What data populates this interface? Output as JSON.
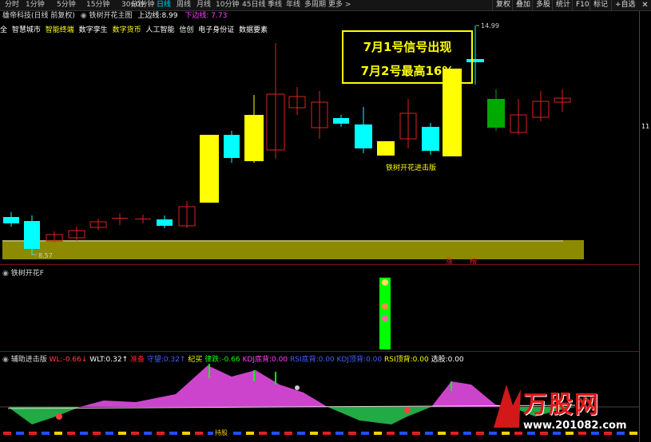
{
  "toolbar": {
    "timeframes": [
      "分时",
      "1分钟",
      "5分钟",
      "15分钟",
      "30分钟",
      "60分钟",
      "日线",
      "周线",
      "月线",
      "10分钟",
      "45日线",
      "季线",
      "年线",
      "多周期",
      "更多 >"
    ],
    "active_timeframe": "日线",
    "right_buttons": [
      "复权",
      "叠加",
      "多股",
      "统计",
      "F10",
      "标记"
    ],
    "right_icon_checkbox": "+自选"
  },
  "title": {
    "stock": "雄帝科技(日线 前复权)",
    "indicator": "铁树开花主图",
    "upper_label": "上边线:",
    "upper_value": "8.99",
    "lower_label": "下边线:",
    "lower_value": "7.73"
  },
  "concepts": [
    "全",
    "智慧城市",
    "智能终端",
    "数字孪生",
    "数字货币",
    "人工智能",
    "信创",
    "电子身份证",
    "数据要素"
  ],
  "callout": {
    "line1": "7月1号信号出现",
    "line2": "7月2号最高16%"
  },
  "main_chart": {
    "price_high_label": "14.99",
    "price_low_label": "8.57",
    "signal_label": "铁树开花进击版",
    "right_edge_label": "11",
    "band_labels": [
      "涨",
      "榜"
    ],
    "colors": {
      "up": "#e02020",
      "down": "#00ffff",
      "signal": "#ffff00",
      "band": "#8c8a00",
      "green": "#00aa00"
    }
  },
  "panel2": {
    "title": "铁树开花F"
  },
  "panel3": {
    "title": "辅助进击版",
    "items": [
      {
        "label": "WL:",
        "value": "-0.66",
        "color": "#ff4040"
      },
      {
        "label": "WLT:",
        "value": "0.32",
        "color": "#ffffff"
      },
      {
        "label": "",
        "value": "准备",
        "color": "#ff2020"
      },
      {
        "label": "守望:",
        "value": "0.32",
        "color": "#4060ff"
      },
      {
        "label": "",
        "value": "纪买",
        "color": "#ffff00"
      },
      {
        "label": "律跌:",
        "value": "-0.66",
        "color": "#00ff00"
      },
      {
        "label": "KDJ底背:",
        "value": "0.00",
        "color": "#ff40ff"
      },
      {
        "label": "RSI底背:",
        "value": "0.00",
        "color": "#4060ff"
      },
      {
        "label": "KDJ顶背:",
        "value": "0.00",
        "color": "#4060ff"
      },
      {
        "label": "RSI顶背:",
        "value": "0.00",
        "color": "#ffff00"
      },
      {
        "label": "选股:",
        "value": "0.00",
        "color": "#ffffff"
      }
    ],
    "bottom_label": "持股"
  },
  "watermark": {
    "text": "万股网",
    "url": "www.201082.com"
  }
}
